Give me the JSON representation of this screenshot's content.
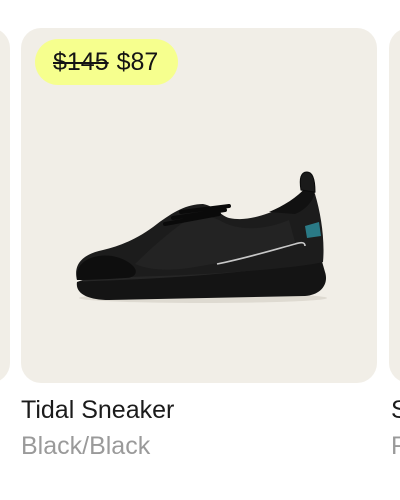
{
  "product": {
    "price_original": "$145",
    "price_sale": "$87",
    "name": "Tidal Sneaker",
    "color": "Black/Black",
    "image_icon": "sneaker-icon"
  },
  "next_product": {
    "name_fragment": "S",
    "color_fragment": "F"
  },
  "colors": {
    "card_bg": "#f1eee7",
    "badge_bg": "#f6ff8e",
    "title": "#1b1b1b",
    "subtitle": "#9a9a9a",
    "shoe_accent": "#2a7a86"
  }
}
